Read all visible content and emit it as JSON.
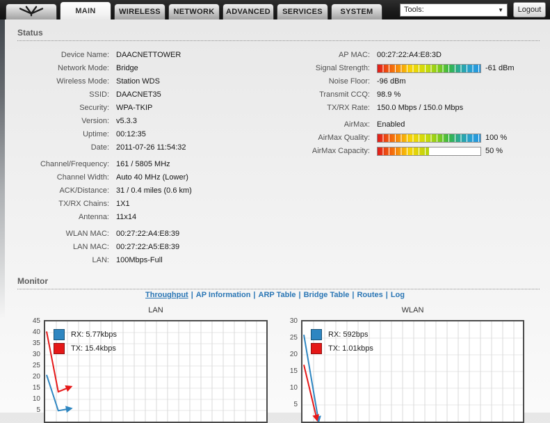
{
  "header": {
    "tabs": [
      "MAIN",
      "WIRELESS",
      "NETWORK",
      "ADVANCED",
      "SERVICES",
      "SYSTEM"
    ],
    "active_tab": "MAIN",
    "tools_label": "Tools:",
    "logout_label": "Logout"
  },
  "status": {
    "title": "Status",
    "left": [
      {
        "label": "Device Name:",
        "value": "DAACNETTOWER"
      },
      {
        "label": "Network Mode:",
        "value": "Bridge"
      },
      {
        "label": "Wireless Mode:",
        "value": "Station WDS"
      },
      {
        "label": "SSID:",
        "value": "DAACNET35"
      },
      {
        "label": "Security:",
        "value": "WPA-TKIP"
      },
      {
        "label": "Version:",
        "value": "v5.3.3"
      },
      {
        "label": "Uptime:",
        "value": "00:12:35"
      },
      {
        "label": "Date:",
        "value": "2011-07-26 11:54:32"
      },
      {
        "label": "Channel/Frequency:",
        "value": "161 / 5805 MHz"
      },
      {
        "label": "Channel Width:",
        "value": "Auto 40 MHz (Lower)"
      },
      {
        "label": "ACK/Distance:",
        "value": "31 / 0.4 miles (0.6 km)"
      },
      {
        "label": "TX/RX Chains:",
        "value": "1X1"
      },
      {
        "label": "Antenna:",
        "value": "11x14"
      },
      {
        "label": "WLAN MAC:",
        "value": "00:27:22:A4:E8:39"
      },
      {
        "label": "LAN MAC:",
        "value": "00:27:22:A5:E8:39"
      },
      {
        "label": "LAN:",
        "value": "100Mbps-Full"
      }
    ],
    "right": [
      {
        "label": "AP MAC:",
        "value": "00:27:22:A4:E8:3D"
      },
      {
        "label": "Signal Strength:",
        "value": "-61 dBm",
        "bar": 100
      },
      {
        "label": "Noise Floor:",
        "value": "-96 dBm"
      },
      {
        "label": "Transmit CCQ:",
        "value": "98.9 %"
      },
      {
        "label": "TX/RX Rate:",
        "value": "150.0 Mbps / 150.0 Mbps"
      },
      {
        "label": "AirMax:",
        "value": "Enabled"
      },
      {
        "label": "AirMax Quality:",
        "value": "100 %",
        "bar": 100
      },
      {
        "label": "AirMax Capacity:",
        "value": "50 %",
        "bar": 50
      }
    ]
  },
  "monitor": {
    "title": "Monitor",
    "separator": "|",
    "links": [
      "Throughput",
      "AP Information",
      "ARP Table",
      "Bridge Table",
      "Routes",
      "Log"
    ],
    "active_link": "Throughput"
  },
  "colors": {
    "rx_blue": "#2e86c1",
    "tx_red": "#e51818",
    "link_blue": "#2a76b5"
  },
  "chart_data": [
    {
      "type": "line",
      "title": "LAN",
      "unit": "kbps",
      "ylim": [
        0,
        45
      ],
      "ytick_step": 5,
      "grid": true,
      "legend_position": "top-left",
      "series": [
        {
          "name": "RX",
          "legend": "RX: 5.77kbps",
          "color": "#2e86c1",
          "border": "#1a5276",
          "x": [
            0,
            1.05,
            2.05
          ],
          "values": [
            21,
            4.9,
            5.77
          ]
        },
        {
          "name": "TX",
          "legend": "TX: 15.4kbps",
          "color": "#e51818",
          "border": "#8e1010",
          "x": [
            0,
            1.05,
            2.05
          ],
          "values": [
            40.5,
            13.4,
            15.4
          ]
        }
      ]
    },
    {
      "type": "line",
      "title": "WLAN",
      "unit": "kbps",
      "ylim": [
        0,
        30
      ],
      "ytick_step": 5,
      "grid": true,
      "legend_position": "top-left",
      "series": [
        {
          "name": "RX",
          "legend": "RX: 592bps",
          "color": "#2e86c1",
          "border": "#1a5276",
          "x": [
            0,
            1.3
          ],
          "values": [
            26,
            0.59
          ]
        },
        {
          "name": "TX",
          "legend": "TX: 1.01kbps",
          "color": "#e51818",
          "border": "#8e1010",
          "x": [
            0,
            1.15
          ],
          "values": [
            17,
            1.01
          ]
        }
      ]
    }
  ]
}
